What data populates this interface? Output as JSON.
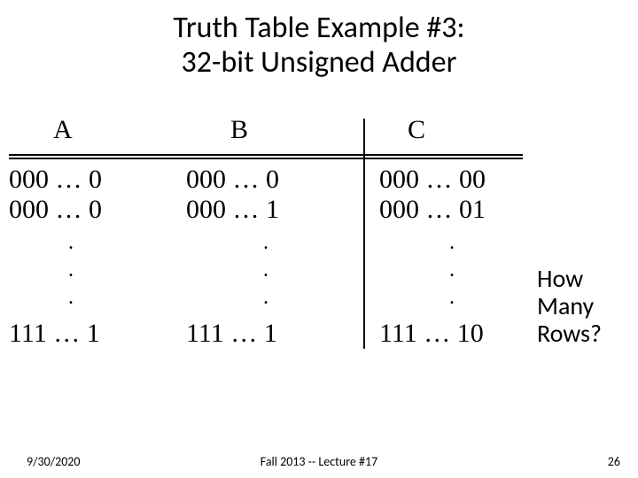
{
  "title": {
    "line1": "Truth Table Example #3:",
    "line2": "32-bit Unsigned Adder"
  },
  "table": {
    "headers": {
      "A": "A",
      "B": "B",
      "C": "C"
    },
    "rows": [
      {
        "A": "000 … 0",
        "B": "000 … 0",
        "C": "000 … 00"
      },
      {
        "A": "000 … 0",
        "B": "000 … 1",
        "C": "000 … 01"
      }
    ],
    "dots": ".",
    "final_row": {
      "A": "111 … 1",
      "B": "111 … 1",
      "C": "111 … 10"
    }
  },
  "annotation": {
    "line1": "How",
    "line2": "Many",
    "line3": "Rows?"
  },
  "footer": {
    "date": "9/30/2020",
    "center": "Fall 2013 -- Lecture #17",
    "page": "26"
  }
}
